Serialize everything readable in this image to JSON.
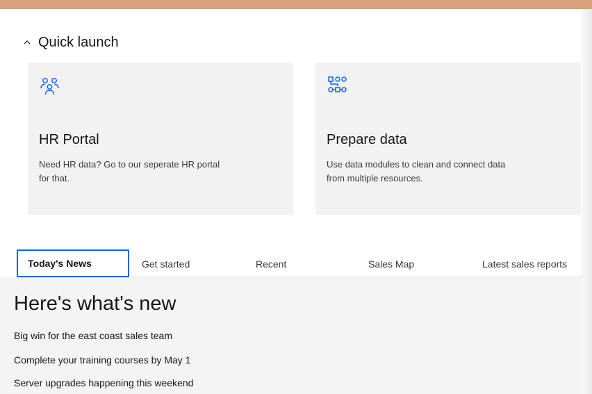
{
  "quick_launch": {
    "heading": "Quick launch",
    "expander_icon": "chevron-up-icon",
    "cards": [
      {
        "icon": "user-group-icon",
        "title": "HR Portal",
        "description": "Need HR data? Go to our seperate HR portal for that."
      },
      {
        "icon": "data-flow-icon",
        "title": "Prepare data",
        "description": "Use data modules to clean and connect data from multiple resources."
      }
    ]
  },
  "tabs": [
    {
      "label": "Today's News",
      "selected": true
    },
    {
      "label": "Get started",
      "selected": false
    },
    {
      "label": "Recent",
      "selected": false
    },
    {
      "label": "Sales Map",
      "selected": false
    },
    {
      "label": "Latest sales reports",
      "selected": false
    }
  ],
  "news": {
    "heading": "Here's what's new",
    "items": [
      "Big win for the east coast sales team",
      "Complete your training courses by May 1",
      "Server upgrades happening this weekend"
    ]
  },
  "colors": {
    "top_bar": "#d7a17e",
    "accent": "#0f62fe",
    "icon": "#0f62fe",
    "card_bg": "#f2f2f2",
    "panel_bg": "#f4f4f4"
  }
}
